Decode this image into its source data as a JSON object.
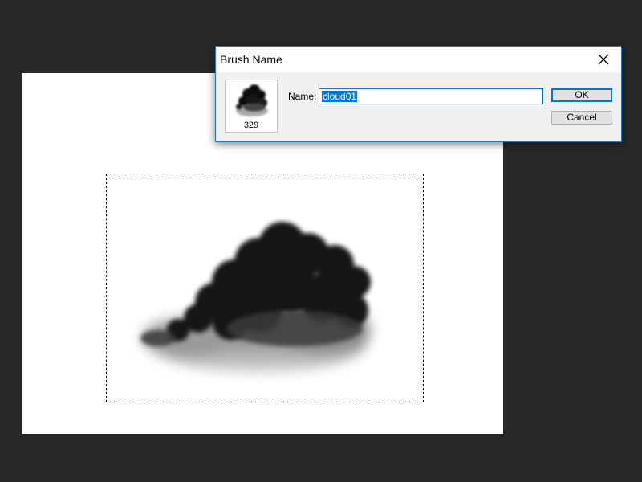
{
  "dialog": {
    "title": "Brush Name",
    "close_icon": "close-icon",
    "preview": {
      "icon": "cloud-brush-thumbnail",
      "size": "329"
    },
    "name_label": "Name:",
    "name_value": "cloud01",
    "ok_label": "OK",
    "cancel_label": "Cancel"
  },
  "canvas": {
    "background": "#ffffff",
    "content_icon": "cloud-image"
  },
  "colors": {
    "workspace": "#282828",
    "accent": "#0078d7",
    "dialog_bg": "#f0f0f0"
  }
}
